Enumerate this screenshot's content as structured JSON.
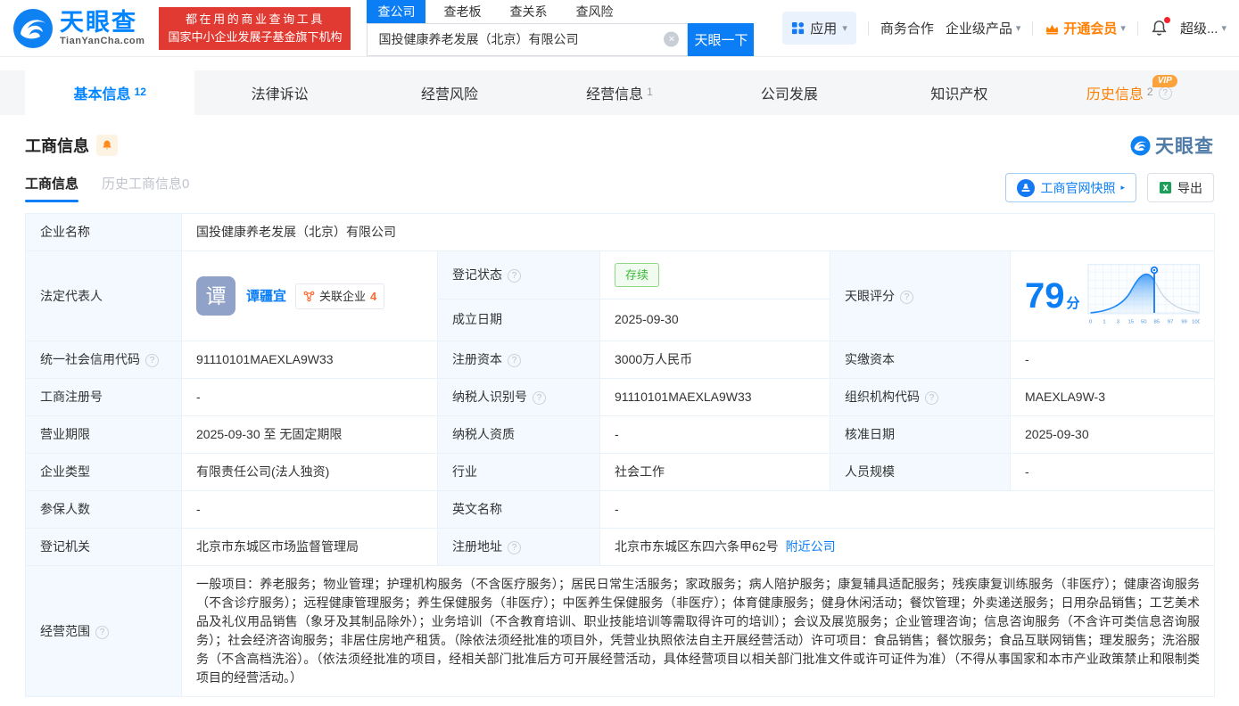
{
  "colors": {
    "accent": "#0084ff",
    "brand_red": "#e13a32",
    "vip_orange": "#ff8000",
    "status_green": "#3cb83c",
    "link_blue": "#0b7ef5"
  },
  "icons": {
    "clear_search": "×",
    "caret_down": "▾",
    "help": "?",
    "snapshot_arrow": "▸"
  },
  "header": {
    "logo": {
      "brand": "天眼查",
      "domain": "TianYanCha.com"
    },
    "slogan": {
      "line1": "都在用的商业查询工具",
      "line2": "国家中小企业发展子基金旗下机构"
    },
    "search": {
      "tabs": [
        {
          "label": "查公司"
        },
        {
          "label": "查老板"
        },
        {
          "label": "查关系"
        },
        {
          "label": "查风险"
        }
      ],
      "value": "国投健康养老发展（北京）有限公司",
      "button": "天眼一下"
    },
    "nav": {
      "apps": "应用",
      "biz": "商务合作",
      "enterprise": "企业级产品",
      "vip": "开通会员",
      "super": "超级..."
    }
  },
  "tabs": [
    {
      "label": "基本信息",
      "count": "12"
    },
    {
      "label": "法律诉讼",
      "count": ""
    },
    {
      "label": "经营风险",
      "count": ""
    },
    {
      "label": "经营信息",
      "count": "1"
    },
    {
      "label": "公司发展",
      "count": ""
    },
    {
      "label": "知识产权",
      "count": ""
    },
    {
      "label": "历史信息",
      "count": "2",
      "vip": "VIP"
    }
  ],
  "section": {
    "title": "工商信息",
    "watermark": "天眼查",
    "subtabs": [
      {
        "label": "工商信息"
      },
      {
        "label": "历史工商信息0"
      }
    ],
    "snapshot_button": "工商官网快照",
    "export_button": "导出"
  },
  "info": {
    "company_name": {
      "label": "企业名称",
      "value": "国投健康养老发展（北京）有限公司"
    },
    "legal_rep": {
      "label": "法定代表人",
      "avatar": "谭",
      "name": "谭疆宜",
      "related_label": "关联企业",
      "related_count": "4"
    },
    "reg_status": {
      "label": "登记状态",
      "value": "存续"
    },
    "established": {
      "label": "成立日期",
      "value": "2025-09-30"
    },
    "score": {
      "label": "天眼评分",
      "value": "79",
      "unit": "分",
      "axis": [
        "0",
        "1",
        "3",
        "15",
        "50",
        "85",
        "97",
        "99",
        "100"
      ]
    },
    "credit_code": {
      "label": "统一社会信用代码",
      "value": "91110101MAEXLA9W33"
    },
    "reg_capital": {
      "label": "注册资本",
      "value": "3000万人民币"
    },
    "paid_capital": {
      "label": "实缴资本",
      "value": "-"
    },
    "reg_number": {
      "label": "工商注册号",
      "value": "-"
    },
    "taxpayer_id": {
      "label": "纳税人识别号",
      "value": "91110101MAEXLA9W33"
    },
    "org_code": {
      "label": "组织机构代码",
      "value": "MAEXLA9W-3"
    },
    "business_term": {
      "label": "营业期限",
      "value": "2025-09-30 至 无固定期限"
    },
    "taxpayer_quality": {
      "label": "纳税人资质",
      "value": "-"
    },
    "approval_date": {
      "label": "核准日期",
      "value": "2025-09-30"
    },
    "company_type": {
      "label": "企业类型",
      "value": "有限责任公司(法人独资)"
    },
    "industry": {
      "label": "行业",
      "value": "社会工作"
    },
    "staff_size": {
      "label": "人员规模",
      "value": "-"
    },
    "insured_count": {
      "label": "参保人数",
      "value": "-"
    },
    "english_name": {
      "label": "英文名称",
      "value": "-"
    },
    "reg_authority": {
      "label": "登记机关",
      "value": "北京市东城区市场监督管理局"
    },
    "reg_address": {
      "label": "注册地址",
      "value": "北京市东城区东四六条甲62号",
      "nearby": "附近公司"
    },
    "business_scope": {
      "label": "经营范围",
      "value": "一般项目：养老服务；物业管理；护理机构服务（不含医疗服务）；居民日常生活服务；家政服务；病人陪护服务；康复辅具适配服务；残疾康复训练服务（非医疗）；健康咨询服务（不含诊疗服务）；远程健康管理服务；养生保健服务（非医疗）；中医养生保健服务（非医疗）；体育健康服务；健身休闲活动；餐饮管理；外卖递送服务；日用杂品销售；工艺美术品及礼仪用品销售（象牙及其制品除外）；业务培训（不含教育培训、职业技能培训等需取得许可的培训）；会议及展览服务；企业管理咨询；信息咨询服务（不含许可类信息咨询服务）；社会经济咨询服务；非居住房地产租赁。（除依法须经批准的项目外，凭营业执照依法自主开展经营活动）许可项目：食品销售；餐饮服务；食品互联网销售；理发服务；洗浴服务（不含高档洗浴）。（依法须经批准的项目，经相关部门批准后方可开展经营活动，具体经营项目以相关部门批准文件或许可证件为准）（不得从事国家和本市产业政策禁止和限制类项目的经营活动。）"
    }
  }
}
